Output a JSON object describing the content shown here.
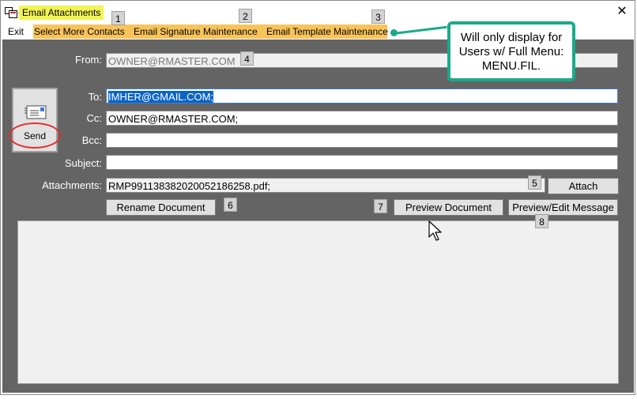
{
  "window": {
    "title": "Email Attachments",
    "close_glyph": "✕"
  },
  "menu": {
    "exit": "Exit",
    "select_more_contacts": "Select More Contacts",
    "email_signature_maintenance": "Email Signature Maintenance",
    "email_template_maintenance": "Email Template Maintenance"
  },
  "callout": {
    "line1": "Will only display for",
    "line2": "Users w/ Full Menu:",
    "line3": "MENU.FIL."
  },
  "form": {
    "from_label": "From:",
    "from_value": "OWNER@RMASTER.COM",
    "to_label": "To:",
    "to_value": "IMHER@GMAIL.COM;",
    "cc_label": "Cc:",
    "cc_value": "OWNER@RMASTER.COM;",
    "bcc_label": "Bcc:",
    "bcc_value": "",
    "subject_label": "Subject:",
    "subject_value": "",
    "attachments_label": "Attachments:",
    "attachments_value": "RMP9911383820200521862​58.pdf;"
  },
  "buttons": {
    "send": "Send",
    "attach": "Attach",
    "rename_document": "Rename Document",
    "preview_document": "Preview Document",
    "preview_edit_message": "Preview/Edit Message"
  },
  "badges": [
    "1",
    "2",
    "3",
    "4",
    "5",
    "6",
    "7",
    "8"
  ],
  "icons": {
    "app": "app-icon",
    "send": "envelope-icon",
    "cursor": "mouse-pointer-icon"
  },
  "colors": {
    "title_highlight": "#f1f553",
    "menu_highlight": "#f8c45a",
    "callout_border": "#1aab8a",
    "panel_bg": "#646464",
    "send_ring": "#e0302e"
  }
}
